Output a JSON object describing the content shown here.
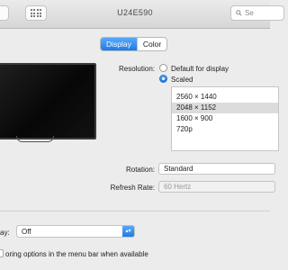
{
  "window": {
    "title": "U24E590",
    "search_placeholder": "Se"
  },
  "tabs": [
    {
      "label": "Display",
      "selected": true
    },
    {
      "label": "Color",
      "selected": false
    }
  ],
  "resolution": {
    "label": "Resolution:",
    "options": [
      {
        "label": "Default for display",
        "selected": false
      },
      {
        "label": "Scaled",
        "selected": true
      }
    ],
    "list": [
      "2560 × 1440",
      "2048 × 1152",
      "1600 × 900",
      "720p"
    ],
    "selected_item": "2048 × 1152"
  },
  "rotation": {
    "label": "Rotation:",
    "value": "Standard"
  },
  "refresh_rate": {
    "label": "Refresh Rate:",
    "value": "60 Hertz"
  },
  "airplay": {
    "label_fragment": "ay:",
    "value": "Off"
  },
  "mirroring_text": "oring options in the menu bar when available",
  "colors": {
    "accent": "#1f7ae6",
    "accent_light": "#5aa9f8"
  }
}
